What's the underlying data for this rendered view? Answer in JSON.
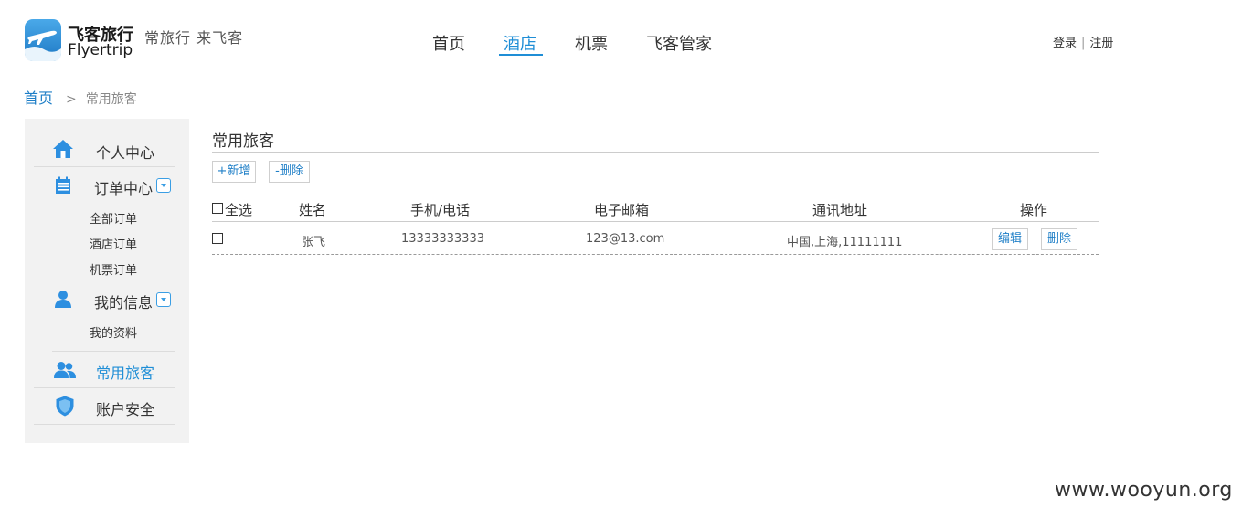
{
  "header": {
    "logo_cn": "飞客旅行",
    "logo_en": "Flyertrip",
    "slogan": "常旅行 来飞客",
    "nav": [
      {
        "label": "首页",
        "active": false
      },
      {
        "label": "酒店",
        "active": true
      },
      {
        "label": "机票",
        "active": false
      },
      {
        "label": "飞客管家",
        "active": false
      }
    ],
    "login": "登录",
    "auth_sep": "|",
    "register": "注册"
  },
  "breadcrumb": {
    "home": "首页",
    "arrow": ">",
    "current": "常用旅客"
  },
  "sidebar": {
    "items": [
      {
        "label": "个人中心",
        "icon": "home-icon"
      },
      {
        "label": "订单中心",
        "icon": "calendar-icon",
        "expandable": true,
        "subitems": [
          "全部订单",
          "酒店订单",
          "机票订单"
        ]
      },
      {
        "label": "我的信息",
        "icon": "user-icon",
        "expandable": true,
        "subitems": [
          "我的资料"
        ]
      },
      {
        "label": "常用旅客",
        "icon": "users-icon",
        "active": true
      },
      {
        "label": "账户安全",
        "icon": "shield-icon"
      }
    ]
  },
  "main": {
    "title": "常用旅客",
    "add_button": "+新增",
    "delete_button": "-删除",
    "columns": {
      "select_all": "全选",
      "name": "姓名",
      "phone": "手机/电话",
      "email": "电子邮箱",
      "address": "通讯地址",
      "actions": "操作"
    },
    "rows": [
      {
        "name": "张飞",
        "phone": "13333333333",
        "email": "123@13.com",
        "address": "中国,上海,11111111",
        "edit": "编辑",
        "delete": "删除"
      }
    ]
  },
  "watermark": "www.wooyun.org",
  "colors": {
    "accent": "#1f8ed6",
    "sidebar_bg": "#f2f2f2"
  }
}
